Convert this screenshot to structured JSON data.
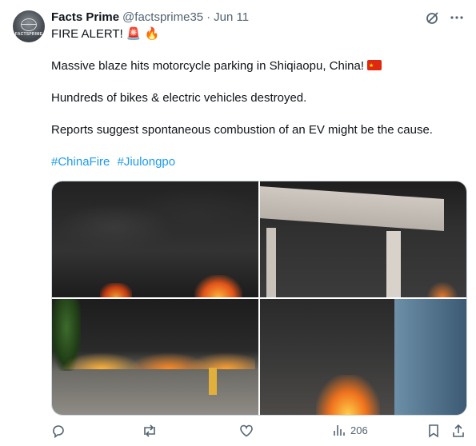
{
  "tweet": {
    "author_name": "Facts Prime",
    "author_handle": "@factsprime35",
    "separator": "·",
    "date": "Jun 11",
    "avatar_brand": "FACTSPRIME",
    "line1": "FIRE ALERT! 🚨 🔥",
    "line2": "Massive blaze hits motorcycle parking in Shiqiaopu, China!",
    "flag_icon": "china-flag-icon",
    "line3": "Hundreds of bikes & electric vehicles destroyed.",
    "line4": "Reports suggest spontaneous combustion of an EV might be the cause.",
    "hashtags": [
      "#ChinaFire",
      "#Jiulongpo"
    ],
    "views_count": "206"
  },
  "icons": {
    "grok": "grok-icon",
    "more": "more-icon",
    "reply": "reply-icon",
    "retweet": "retweet-icon",
    "like": "like-icon",
    "views": "views-icon",
    "bookmark": "bookmark-icon",
    "share": "share-icon"
  },
  "colors": {
    "link": "#1d9bf0",
    "secondary_text": "#536471",
    "primary_text": "#0f1419"
  }
}
